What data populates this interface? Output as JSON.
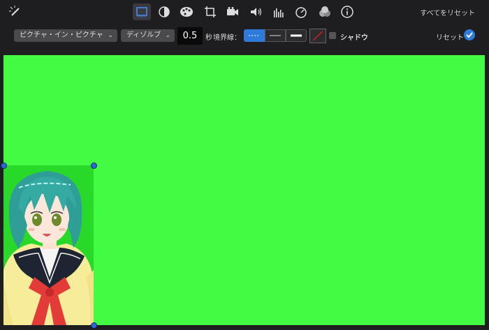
{
  "toolbar": {
    "tools": [
      "magic-wand-icon",
      "crop-frame-icon",
      "color-balance-icon",
      "palette-icon",
      "crop-icon",
      "camera-icon",
      "volume-icon",
      "equalizer-icon",
      "speed-icon",
      "filter-icon",
      "info-icon"
    ],
    "reset_all": "すべてをリセット"
  },
  "options": {
    "overlay_style": "ピクチャ・イン・ピクチャ",
    "transition": "ディゾルブ",
    "duration": "0.5",
    "seconds_label": "秒",
    "border_label": "境界線：",
    "shadow_label": "シャドウ",
    "reset_label": "リセット"
  },
  "colors": {
    "greenscreen": "#44fb44",
    "accent": "#2f7bdc"
  }
}
